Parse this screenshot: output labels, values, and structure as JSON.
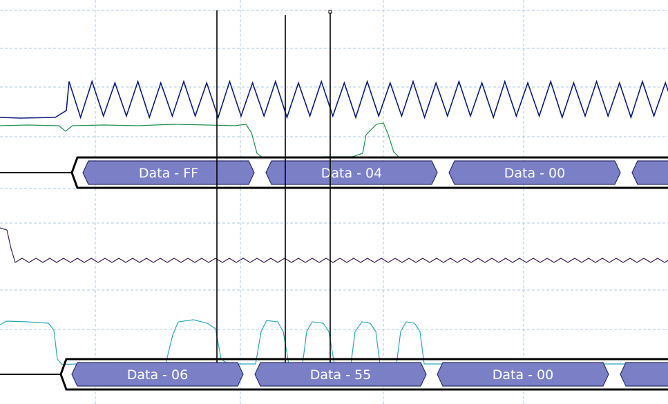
{
  "colors": {
    "background": "#ffffff",
    "grid": "#a8c8e8",
    "clock_trace": "#0a1a7a",
    "data_trace": "#1e8f4e",
    "slow_trace": "#3a1f55",
    "cyan_trace": "#2aa7b8",
    "packet_fill": "#7b80c6",
    "packet_stroke": "#2a2f6a",
    "bus_outline": "#000000",
    "cursor": "#000000"
  },
  "buses": [
    {
      "name": "upper-decode-bus",
      "packets": [
        {
          "label": "Data - FF"
        },
        {
          "label": "Data - 04"
        },
        {
          "label": "Data - 00"
        },
        {
          "label": ""
        }
      ]
    },
    {
      "name": "lower-decode-bus",
      "packets": [
        {
          "label": "Data - 06"
        },
        {
          "label": "Data - 55"
        },
        {
          "label": "Data - 00"
        },
        {
          "label": ""
        }
      ]
    }
  ],
  "cursors": [
    {
      "name": "cursor-1"
    },
    {
      "name": "cursor-2"
    },
    {
      "name": "cursor-3"
    }
  ]
}
